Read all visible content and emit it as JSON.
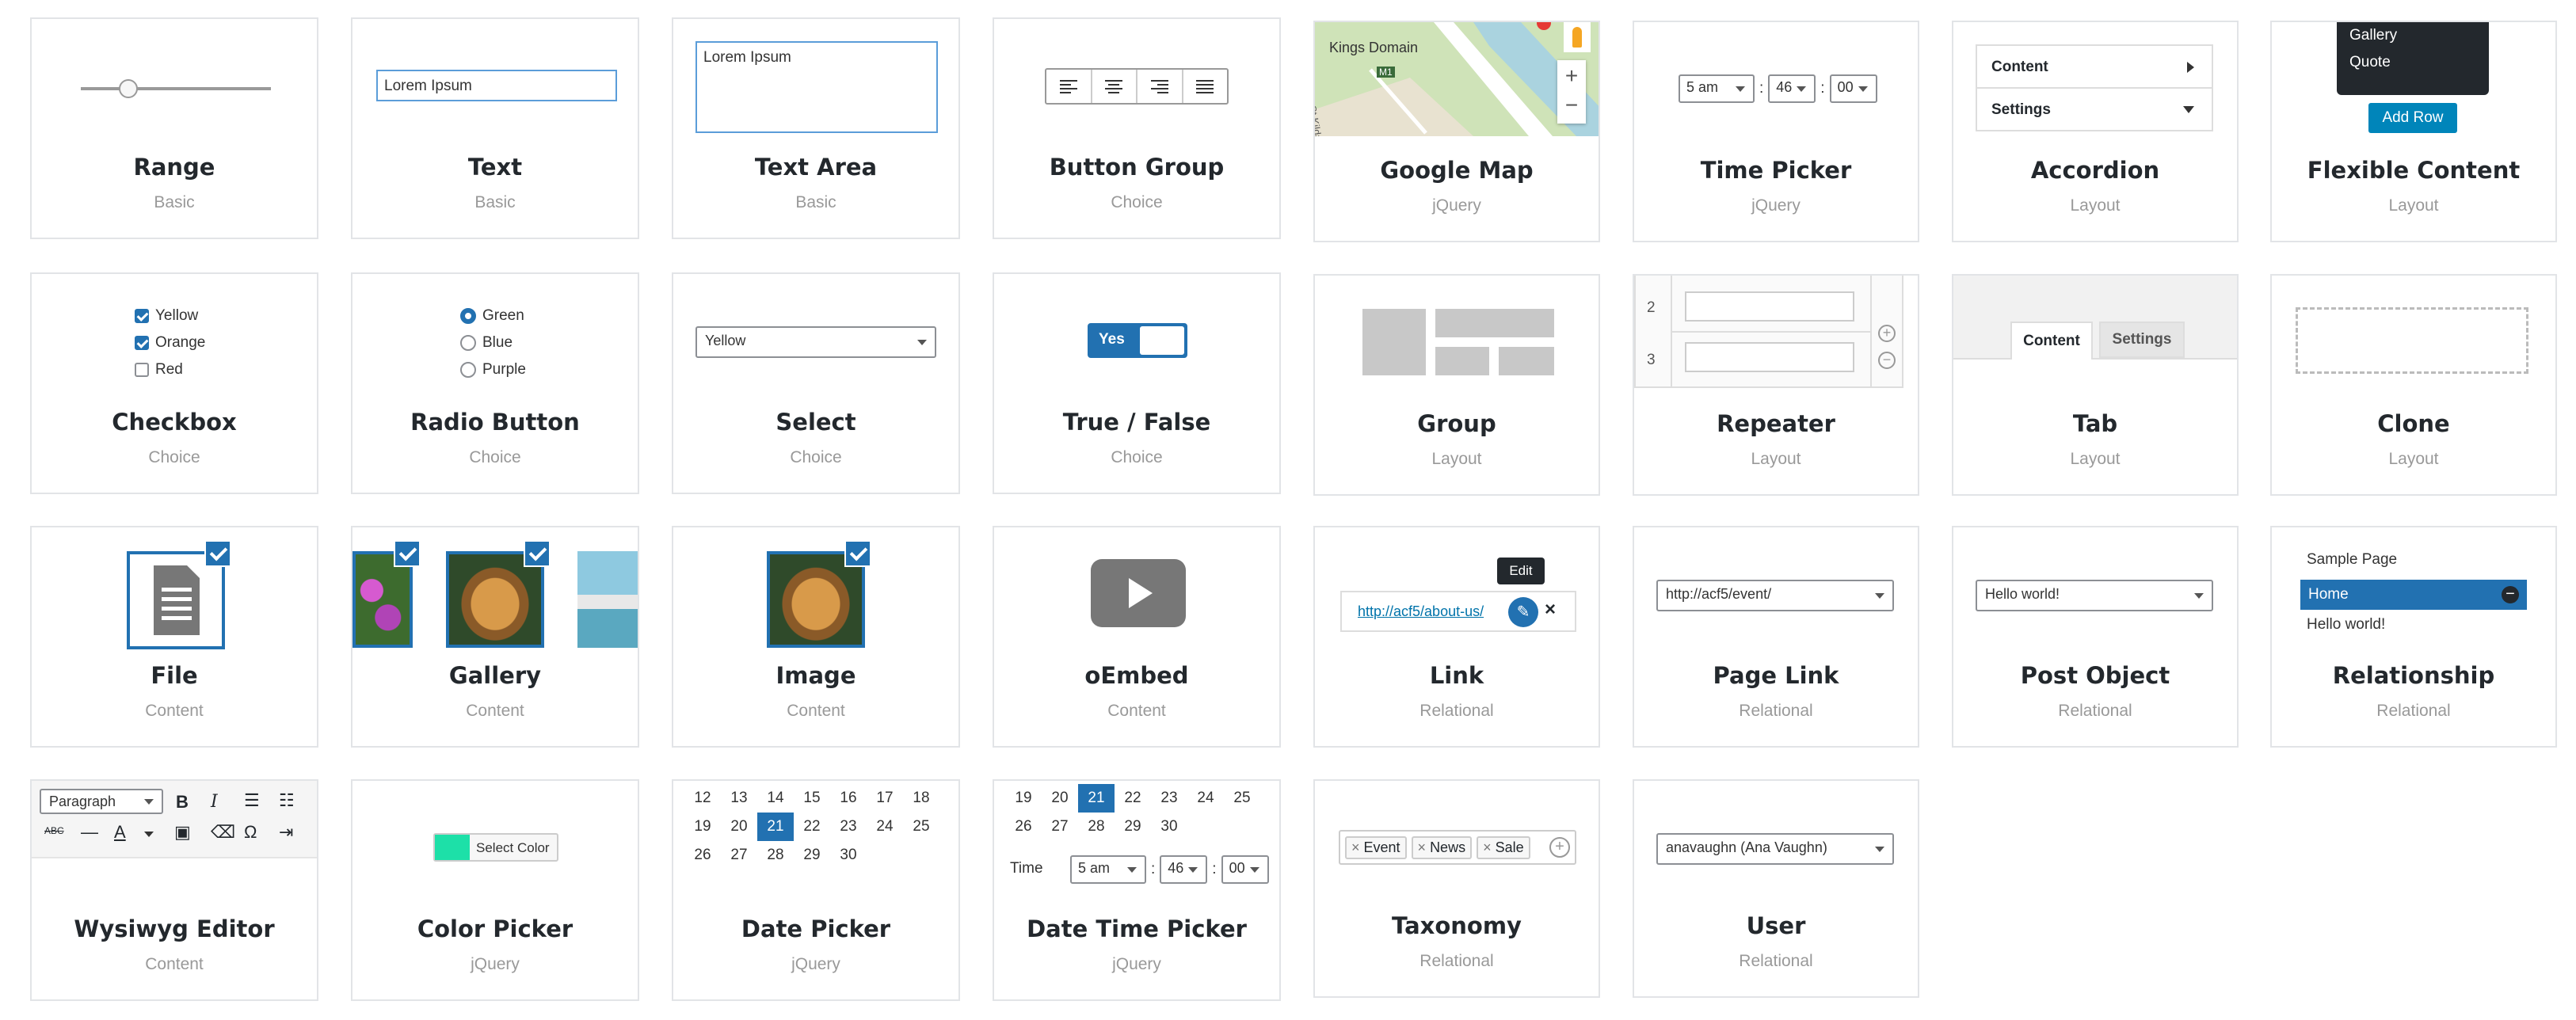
{
  "cards": [
    {
      "title": "Range",
      "category": "Basic"
    },
    {
      "title": "Text",
      "category": "Basic"
    },
    {
      "title": "Text Area",
      "category": "Basic"
    },
    {
      "title": "Button Group",
      "category": "Choice"
    },
    {
      "title": "Google Map",
      "category": "jQuery"
    },
    {
      "title": "Time Picker",
      "category": "jQuery"
    },
    {
      "title": "Accordion",
      "category": "Layout"
    },
    {
      "title": "Flexible Content",
      "category": "Layout"
    },
    {
      "title": "Checkbox",
      "category": "Choice"
    },
    {
      "title": "Radio Button",
      "category": "Choice"
    },
    {
      "title": "Select",
      "category": "Choice"
    },
    {
      "title": "True / False",
      "category": "Choice"
    },
    {
      "title": "Group",
      "category": "Layout"
    },
    {
      "title": "Repeater",
      "category": "Layout"
    },
    {
      "title": "Tab",
      "category": "Layout"
    },
    {
      "title": "Clone",
      "category": "Layout"
    },
    {
      "title": "File",
      "category": "Content"
    },
    {
      "title": "Gallery",
      "category": "Content"
    },
    {
      "title": "Image",
      "category": "Content"
    },
    {
      "title": "oEmbed",
      "category": "Content"
    },
    {
      "title": "Link",
      "category": "Relational"
    },
    {
      "title": "Page Link",
      "category": "Relational"
    },
    {
      "title": "Post Object",
      "category": "Relational"
    },
    {
      "title": "Relationship",
      "category": "Relational"
    },
    {
      "title": "Wysiwyg Editor",
      "category": "Content"
    },
    {
      "title": "Color Picker",
      "category": "jQuery"
    },
    {
      "title": "Date Picker",
      "category": "jQuery"
    },
    {
      "title": "Date Time Picker",
      "category": "jQuery"
    },
    {
      "title": "Taxonomy",
      "category": "Relational"
    },
    {
      "title": "User",
      "category": "Relational"
    }
  ],
  "previews": {
    "text_value": "Lorem Ipsum",
    "textarea_value": "Lorem Ipsum",
    "map_label": "Kings Domain",
    "map_road": "M1",
    "map_street": "St Kilda",
    "time": {
      "hour": "5 am",
      "minute": "46",
      "second": "00"
    },
    "accordion": [
      "Content",
      "Settings"
    ],
    "flexible": {
      "menu": [
        "Gallery",
        "Quote"
      ],
      "button": "Add Row"
    },
    "checkbox": [
      {
        "label": "Yellow",
        "checked": true
      },
      {
        "label": "Orange",
        "checked": true
      },
      {
        "label": "Red",
        "checked": false
      }
    ],
    "radio": [
      {
        "label": "Green",
        "checked": true
      },
      {
        "label": "Blue",
        "checked": false
      },
      {
        "label": "Purple",
        "checked": false
      }
    ],
    "select_value": "Yellow",
    "truefalse_label": "Yes",
    "repeater_rows": [
      "2",
      "3"
    ],
    "tabs": [
      "Content",
      "Settings"
    ],
    "link": {
      "url": "http://acf5/about-us/",
      "tooltip": "Edit"
    },
    "page_link_value": "http://acf5/event/",
    "post_object_value": "Hello world!",
    "relationship": [
      "Sample Page",
      "Home",
      "Hello world!"
    ],
    "wysiwyg_format": "Paragraph",
    "color_button": "Select Color",
    "color_value": "#1de0a8",
    "date_rows": [
      [
        "12",
        "13",
        "14",
        "15",
        "16",
        "17",
        "18"
      ],
      [
        "19",
        "20",
        "21",
        "22",
        "23",
        "24",
        "25"
      ],
      [
        "26",
        "27",
        "28",
        "29",
        "30",
        "",
        ""
      ]
    ],
    "date_selected": "21",
    "datetime_rows": [
      [
        "19",
        "20",
        "21",
        "22",
        "23",
        "24",
        "25"
      ],
      [
        "26",
        "27",
        "28",
        "29",
        "30",
        "",
        ""
      ]
    ],
    "datetime_label": "Time",
    "taxonomy_tags": [
      "Event",
      "News",
      "Sale"
    ],
    "user_value": "anavaughn (Ana Vaughn)"
  },
  "colors": {
    "accent": "#2271b1",
    "border": "#e2e4e7"
  }
}
